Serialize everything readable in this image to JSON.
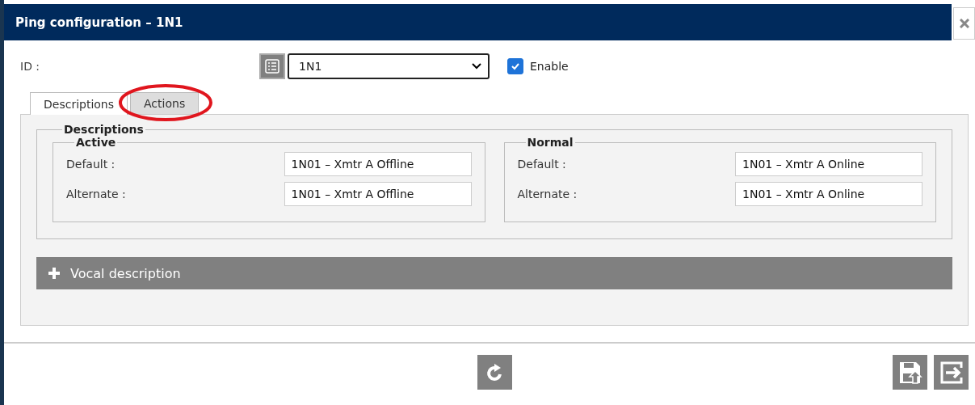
{
  "window": {
    "title": "Ping configuration – 1N1"
  },
  "id_field": {
    "label": "ID :",
    "value": "1N1"
  },
  "enable": {
    "label": "Enable",
    "checked": true
  },
  "tabs": [
    {
      "label": "Descriptions",
      "selected": true,
      "circled": false
    },
    {
      "label": "Actions",
      "selected": false,
      "circled": true
    }
  ],
  "descriptions": {
    "title": "Descriptions",
    "groups": [
      {
        "title": "Active",
        "fields": [
          {
            "label": "Default :",
            "value": "1N01 – Xmtr A Offline"
          },
          {
            "label": "Alternate :",
            "value": "1N01 – Xmtr A Offline"
          }
        ]
      },
      {
        "title": "Normal",
        "fields": [
          {
            "label": "Default :",
            "value": "1N01 – Xmtr A Online"
          },
          {
            "label": "Alternate :",
            "value": "1N01 – Xmtr A Online"
          }
        ]
      }
    ]
  },
  "vocal_description": {
    "label": "Vocal description",
    "expanded": false
  }
}
